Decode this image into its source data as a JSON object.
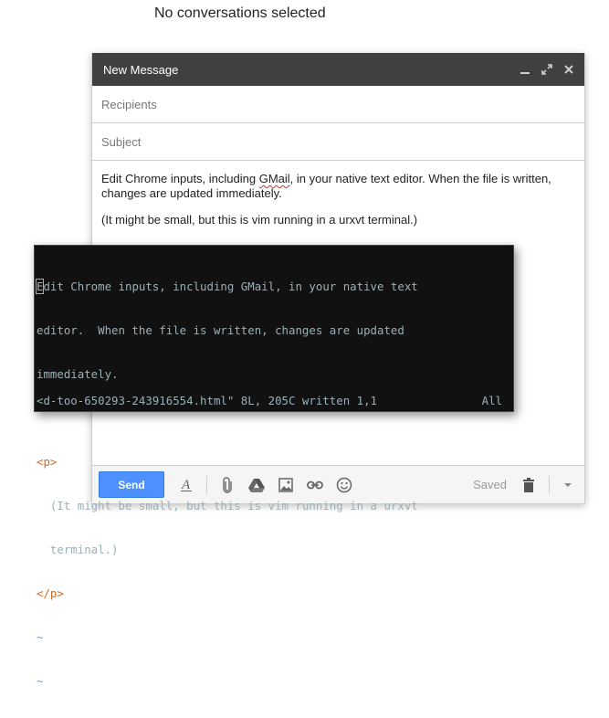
{
  "page": {
    "empty_state": "No conversations selected"
  },
  "compose": {
    "title": "New Message",
    "header_icons": [
      "minimize-icon",
      "expand-icon",
      "close-icon"
    ],
    "recipients_placeholder": "Recipients",
    "subject_placeholder": "Subject",
    "body": {
      "para1_before": "Edit Chrome inputs, including ",
      "para1_misspelled": "GMail",
      "para1_after": ", in your native text editor. When the file is written, changes are updated immediately.",
      "para2": "(It might be small, but this is vim running in a urxvt terminal.)"
    },
    "toolbar": {
      "send_label": "Send",
      "icons": [
        "text-format-icon",
        "attach-icon",
        "drive-icon",
        "photo-icon",
        "link-icon",
        "emoji-icon"
      ],
      "saved_label": "Saved",
      "trash_icon": "trash-icon",
      "more_icon": "more-options-icon"
    }
  },
  "terminal": {
    "cursor_char": "E",
    "lines": {
      "l1": "dit Chrome inputs, including GMail, in your native text",
      "l2": "editor.  When the file is written, changes are updated",
      "l3": "immediately.",
      "l4": "",
      "l5": "<p>",
      "l6": "  (It might be small, but this is vim running in a urxvt",
      "l7": "  terminal.)",
      "l8": "</p>",
      "l9": "~",
      "l10": "~"
    },
    "status_left": "<d-too-650293-243916554.html\" 8L, 205C written 1,1",
    "status_right": "All"
  },
  "colors": {
    "header_bg": "#404040",
    "send_button": "#4d90fe",
    "terminal_bg": "#111111",
    "terminal_text": "#9ab0b8",
    "html_tag": "#d2691e",
    "tilde": "#6ca0dc"
  }
}
